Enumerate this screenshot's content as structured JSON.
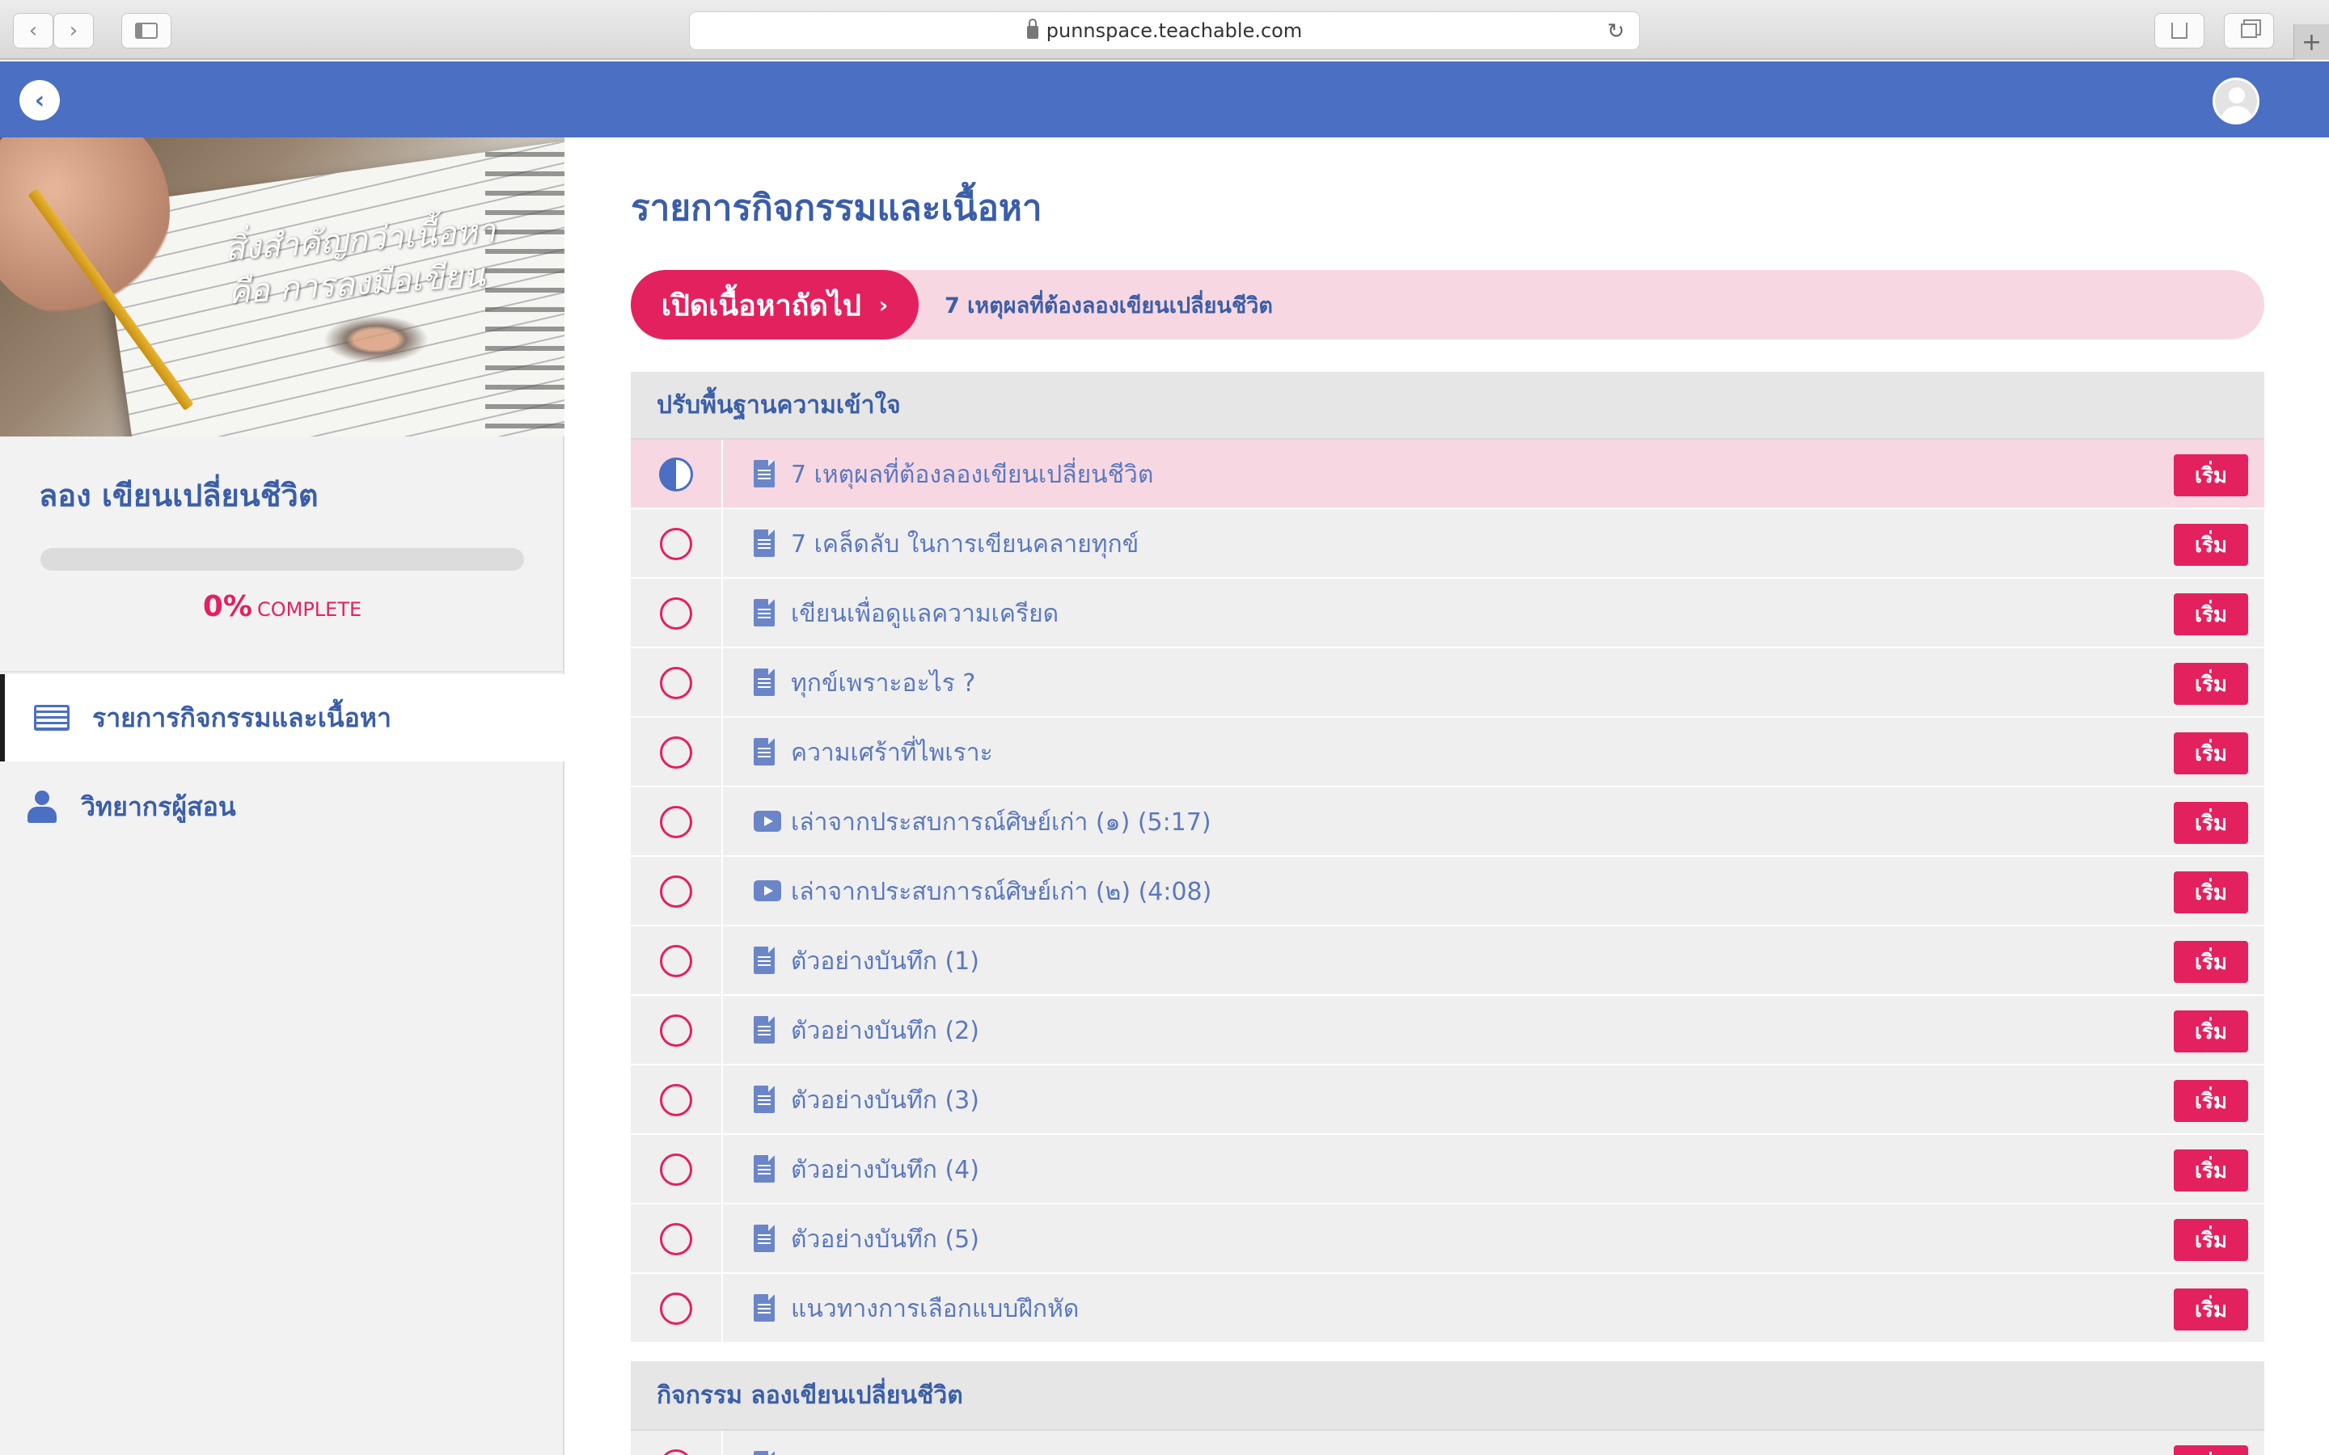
{
  "browser": {
    "url": "punnspace.teachable.com",
    "back_glyph": "‹",
    "forward_glyph": "›",
    "reload_glyph": "↻",
    "new_tab_glyph": "+"
  },
  "header": {
    "back_glyph": "‹"
  },
  "sidebar": {
    "image_quote_line1": "สิ่งสำคัญกว่าเนื้อหา",
    "image_quote_line2": "คือ การลงมือเขียน",
    "course_title": "ลอง เขียนเปลี่ยนชีวิต",
    "progress_percent": 0,
    "progress_value": "0%",
    "progress_label": "COMPLETE",
    "nav": [
      {
        "label": "รายการกิจกรรมและเนื้อหา",
        "icon": "list-icon",
        "active": true
      },
      {
        "label": "วิทยากรผู้สอน",
        "icon": "person-icon",
        "active": false
      }
    ]
  },
  "main": {
    "page_title": "รายการกิจกรรมและเนื้อหา",
    "next_button_label": "เปิดเนื้อหาถัดไป",
    "next_button_chevron": "›",
    "next_lecture_title": "7 เหตุผลที่ต้องลองเขียนเปลี่ยนชีวิต",
    "start_label": "เริ่ม",
    "sections": [
      {
        "title": "ปรับพื้นฐานความเข้าใจ",
        "lectures": [
          {
            "title": "7 เหตุผลที่ต้องลองเขียนเปลี่ยนชีวิต",
            "type": "document-icon",
            "status": "in-progress"
          },
          {
            "title": "7 เคล็ดลับ ในการเขียนคลายทุกข์",
            "type": "document-icon",
            "status": "not-started"
          },
          {
            "title": "เขียนเพื่อดูแลความเครียด",
            "type": "document-icon",
            "status": "not-started"
          },
          {
            "title": "ทุกข์เพราะอะไร ?",
            "type": "document-icon",
            "status": "not-started"
          },
          {
            "title": "ความเศร้าที่ไพเราะ",
            "type": "document-icon",
            "status": "not-started"
          },
          {
            "title": "เล่าจากประสบการณ์ศิษย์เก่า (๑) (5:17)",
            "type": "video-icon",
            "status": "not-started"
          },
          {
            "title": "เล่าจากประสบการณ์ศิษย์เก่า (๒) (4:08)",
            "type": "video-icon",
            "status": "not-started"
          },
          {
            "title": "ตัวอย่างบันทึก (1)",
            "type": "document-icon",
            "status": "not-started"
          },
          {
            "title": "ตัวอย่างบันทึก (2)",
            "type": "document-icon",
            "status": "not-started"
          },
          {
            "title": "ตัวอย่างบันทึก (3)",
            "type": "document-icon",
            "status": "not-started"
          },
          {
            "title": "ตัวอย่างบันทึก (4)",
            "type": "document-icon",
            "status": "not-started"
          },
          {
            "title": "ตัวอย่างบันทึก (5)",
            "type": "document-icon",
            "status": "not-started"
          },
          {
            "title": "แนวทางการเลือกแบบฝึกหัด",
            "type": "document-icon",
            "status": "not-started"
          }
        ]
      },
      {
        "title": "กิจกรรม ลองเขียนเปลี่ยนชีวิต",
        "lectures": []
      }
    ]
  },
  "colors": {
    "header_blue": "#4a6fc3",
    "title_blue": "#3b5ea8",
    "accent_pink": "#e3215e",
    "current_row_pink": "#f7d8e2"
  }
}
